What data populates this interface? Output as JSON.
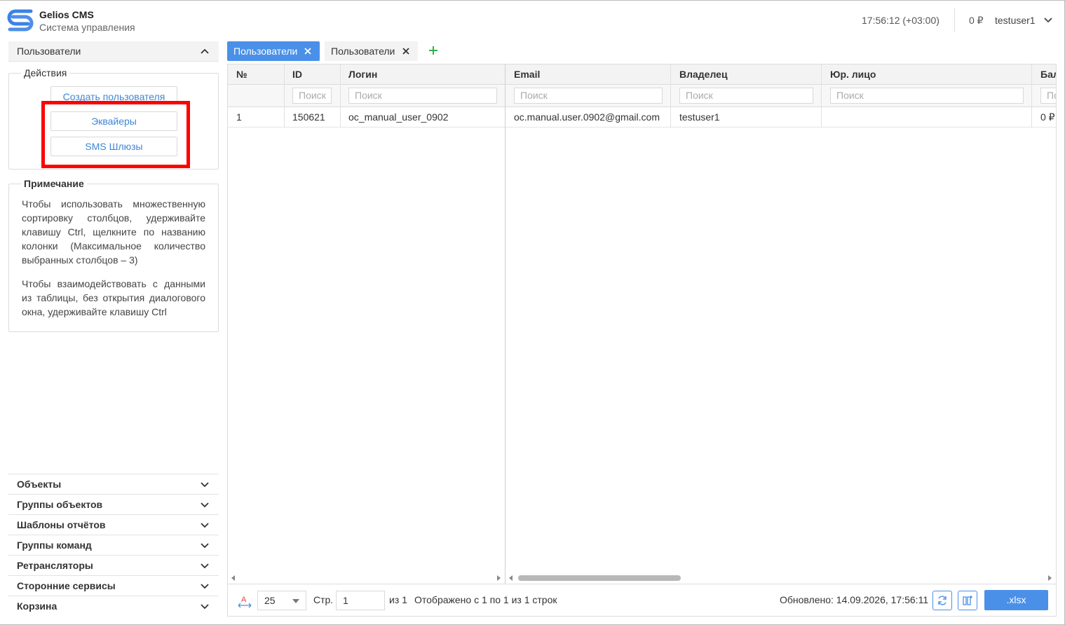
{
  "header": {
    "app_title": "Gelios CMS",
    "app_subtitle": "Система управления",
    "time": "17:56:12 (+03:00)",
    "balance": "0 ₽",
    "username": "testuser1"
  },
  "sidebar": {
    "section_title": "Пользователи",
    "actions_legend": "Действия",
    "actions": {
      "create_user": "Создать пользователя",
      "acquirers": "Эквайеры",
      "sms_gateways": "SMS Шлюзы"
    },
    "note_legend": "Примечание",
    "note_p1": "Чтобы использовать множественную сортировку столбцов, удерживайте клавишу Ctrl, щелкните по названию колонки (Максимальное количество выбранных столбцов – 3)",
    "note_p2": "Чтобы взаимодействовать с данными из таблицы, без открытия диалогового окна, удерживайте клавишу Ctrl",
    "accordion": [
      "Объекты",
      "Группы объектов",
      "Шаблоны отчётов",
      "Группы команд",
      "Ретрансляторы",
      "Сторонние сервисы",
      "Корзина"
    ]
  },
  "tabs": [
    {
      "label": "Пользователи",
      "active": true
    },
    {
      "label": "Пользователи",
      "active": false
    }
  ],
  "table": {
    "columns": [
      "№",
      "ID",
      "Логин",
      "Email",
      "Владелец",
      "Юр. лицо",
      "Бал"
    ],
    "filter_placeholder": "Поиск",
    "filter_placeholder_short_id": "Поиск",
    "filter_placeholder_short_last": "По",
    "rows": [
      {
        "num": "1",
        "id": "150621",
        "login": "oc_manual_user_0902",
        "email": "oc.manual.user.0902@gmail.com",
        "owner": "testuser1",
        "legal": "",
        "balance": "0 ₽"
      }
    ]
  },
  "footer": {
    "page_size": "25",
    "page_label": "Стр.",
    "page_value": "1",
    "of_label": "из 1",
    "shown_label": "Отображено с 1 по 1 из 1 строк",
    "updated_label": "Обновлено: 14.09.2026, 17:56:11",
    "export_label": ".xlsx"
  },
  "colors": {
    "accent": "#4a90e8",
    "highlight": "#ff0000",
    "link": "#3f86d6",
    "add_tab": "#2db34a"
  },
  "icons": [
    "logo-icon",
    "chevron-up-icon",
    "chevron-down-icon",
    "close-icon",
    "plus-icon",
    "font-size-icon",
    "refresh-icon",
    "columns-icon"
  ]
}
